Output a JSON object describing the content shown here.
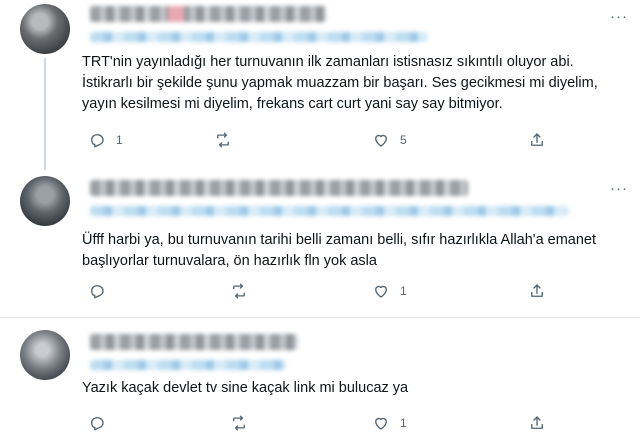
{
  "tweets": [
    {
      "text": "TRT'nin yayınladığı her turnuvanın ilk zamanları istisnasız sıkıntılı oluyor abi. İstikrarlı bir şekilde şunu yapmak muazzam bir başarı. Ses gecikmesi mi diyelim, yayın kesilmesi mi diyelim, frekans cart curt yani say say bitmiyor.",
      "replies": "1",
      "retweets": "",
      "likes": "5",
      "more": "···"
    },
    {
      "text": "Üfff harbi ya, bu turnuvanın tarihi belli zamanı belli, sıfır hazırlıkla Allah'a emanet başlıyorlar turnuvalara, ön hazırlık fln yok asla",
      "replies": "",
      "retweets": "",
      "likes": "1",
      "more": "···"
    },
    {
      "text": "Yazık kaçak devlet tv sine kaçak link mi bulucaz ya",
      "replies": "",
      "retweets": "",
      "likes": "1",
      "more": ""
    }
  ],
  "icons": [
    "reply-icon",
    "retweet-icon",
    "like-icon",
    "share-icon",
    "more-icon"
  ],
  "colors": {
    "text": "#0f1419",
    "muted": "#536471",
    "divider": "#e4e8eb",
    "thread_line": "#cfd9de"
  }
}
